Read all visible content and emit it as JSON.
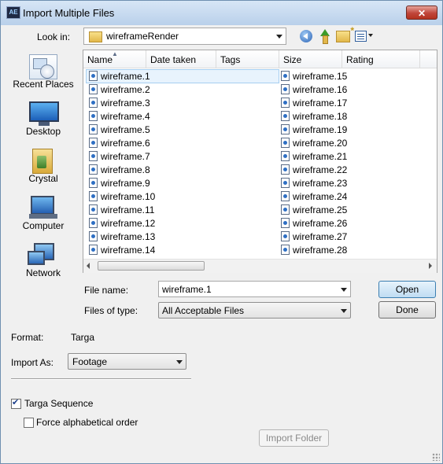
{
  "window": {
    "title": "Import Multiple Files",
    "app_icon": "AE",
    "close_label": "✕"
  },
  "toolbar": {
    "look_in_label": "Look in:",
    "look_in_value": "wireframeRender"
  },
  "places": [
    {
      "label": "Recent Places",
      "icon": "recent-places-icon"
    },
    {
      "label": "Desktop",
      "icon": "desktop-icon"
    },
    {
      "label": "Crystal",
      "icon": "user-folder-icon"
    },
    {
      "label": "Computer",
      "icon": "computer-icon"
    },
    {
      "label": "Network",
      "icon": "network-icon"
    }
  ],
  "file_list": {
    "columns": [
      "Name",
      "Date taken",
      "Tags",
      "Size",
      "Rating"
    ],
    "files": [
      "wireframe.1",
      "wireframe.2",
      "wireframe.3",
      "wireframe.4",
      "wireframe.5",
      "wireframe.6",
      "wireframe.7",
      "wireframe.8",
      "wireframe.9",
      "wireframe.10",
      "wireframe.11",
      "wireframe.12",
      "wireframe.13",
      "wireframe.14",
      "wireframe.15",
      "wireframe.16",
      "wireframe.17",
      "wireframe.18",
      "wireframe.19",
      "wireframe.20",
      "wireframe.21",
      "wireframe.22",
      "wireframe.23",
      "wireframe.24",
      "wireframe.25",
      "wireframe.26",
      "wireframe.27",
      "wireframe.28"
    ],
    "selected": "wireframe.1"
  },
  "filename": {
    "label": "File name:",
    "value": "wireframe.1"
  },
  "filetype": {
    "label": "Files of type:",
    "value": "All Acceptable Files"
  },
  "buttons": {
    "open": "Open",
    "done": "Done",
    "import_folder": "Import Folder"
  },
  "format": {
    "label": "Format:",
    "value": "Targa"
  },
  "import_as": {
    "label": "Import As:",
    "value": "Footage"
  },
  "options": {
    "targa_sequence": {
      "label": "Targa Sequence",
      "checked": true
    },
    "force_alpha": {
      "label": "Force alphabetical order",
      "checked": false
    }
  },
  "colors": {
    "selection_bg": "#e8f3fd",
    "title_gradient_top": "#d7e6f6",
    "close_red": "#c0463a"
  }
}
